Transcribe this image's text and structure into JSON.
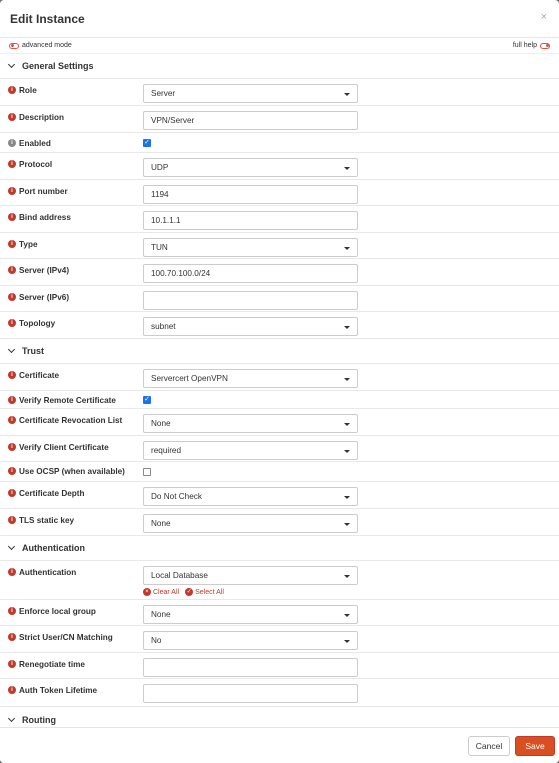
{
  "dialog": {
    "title": "Edit Instance",
    "close": "×"
  },
  "modebar": {
    "advanced": "advanced mode",
    "fullhelp": "full help"
  },
  "sections": {
    "general": "General Settings",
    "trust": "Trust",
    "authentication": "Authentication",
    "routing": "Routing"
  },
  "fields": {
    "role": {
      "label": "Role",
      "value": "Server"
    },
    "description": {
      "label": "Description",
      "value": "VPN/Server"
    },
    "enabled": {
      "label": "Enabled",
      "checked": true
    },
    "protocol": {
      "label": "Protocol",
      "value": "UDP"
    },
    "port": {
      "label": "Port number",
      "value": "1194"
    },
    "bind": {
      "label": "Bind address",
      "value": "10.1.1.1"
    },
    "type": {
      "label": "Type",
      "value": "TUN"
    },
    "server4": {
      "label": "Server (IPv4)",
      "value": "100.70.100.0/24"
    },
    "server6": {
      "label": "Server (IPv6)",
      "value": ""
    },
    "topology": {
      "label": "Topology",
      "value": "subnet"
    },
    "certificate": {
      "label": "Certificate",
      "value": "Servercert OpenVPN"
    },
    "verify_remote": {
      "label": "Verify Remote Certificate",
      "checked": true
    },
    "crl": {
      "label": "Certificate Revocation List",
      "value": "None"
    },
    "verify_client": {
      "label": "Verify Client Certificate",
      "value": "required"
    },
    "ocsp": {
      "label": "Use OCSP (when available)",
      "checked": false
    },
    "cert_depth": {
      "label": "Certificate Depth",
      "value": "Do Not Check"
    },
    "tls_key": {
      "label": "TLS static key",
      "value": "None"
    },
    "auth": {
      "label": "Authentication",
      "value": "Local Database",
      "clear": "Clear All",
      "select": "Select All"
    },
    "local_group": {
      "label": "Enforce local group",
      "value": "None"
    },
    "strict_cn": {
      "label": "Strict User/CN Matching",
      "value": "No"
    },
    "reneg": {
      "label": "Renegotiate time",
      "value": ""
    },
    "token": {
      "label": "Auth Token Lifetime",
      "value": ""
    }
  },
  "footer": {
    "cancel": "Cancel",
    "save": "Save"
  },
  "colors": {
    "accent": "#d94f22",
    "info": "#c0392b",
    "check": "#1a73e8"
  }
}
